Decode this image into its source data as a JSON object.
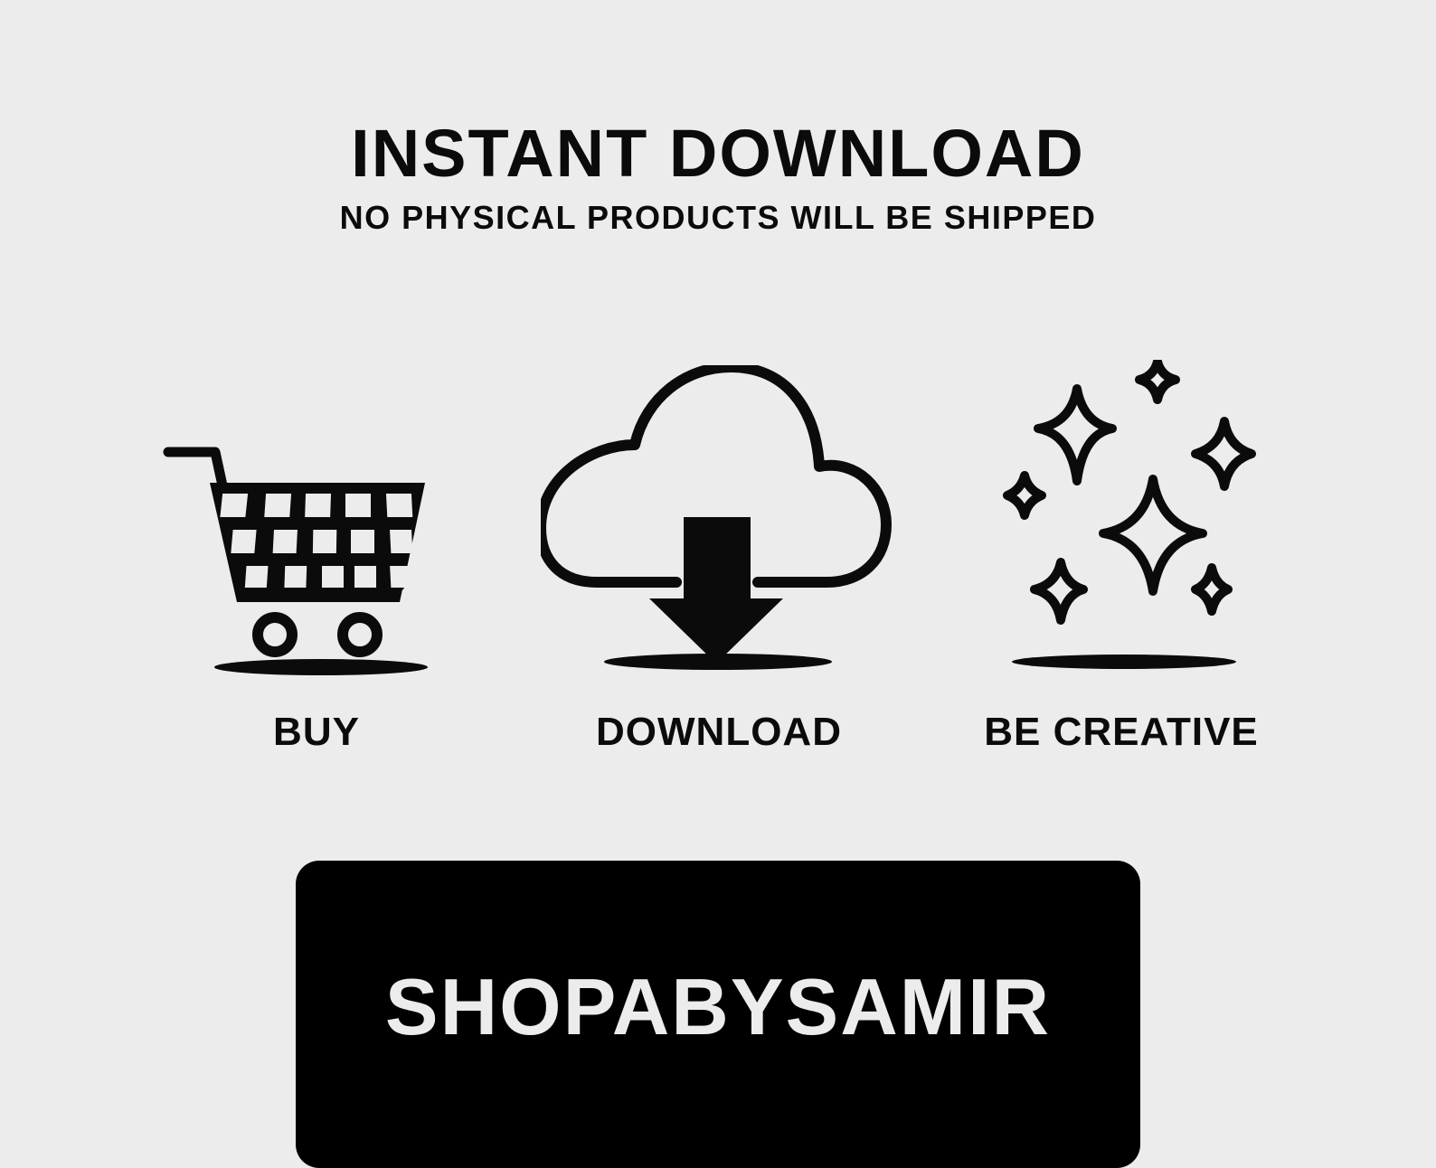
{
  "header": {
    "title": "INSTANT DOWNLOAD",
    "subtitle": "NO PHYSICAL PRODUCTS WILL BE SHIPPED"
  },
  "steps": [
    {
      "icon": "shopping-cart-icon",
      "label": "BUY"
    },
    {
      "icon": "cloud-download-icon",
      "label": "DOWNLOAD"
    },
    {
      "icon": "sparkles-icon",
      "label": "BE CREATIVE"
    }
  ],
  "brand": {
    "name": "SHOPABYSAMIR"
  },
  "colors": {
    "background": "#ececec",
    "ink": "#0b0b0b",
    "banner": "#000000"
  }
}
